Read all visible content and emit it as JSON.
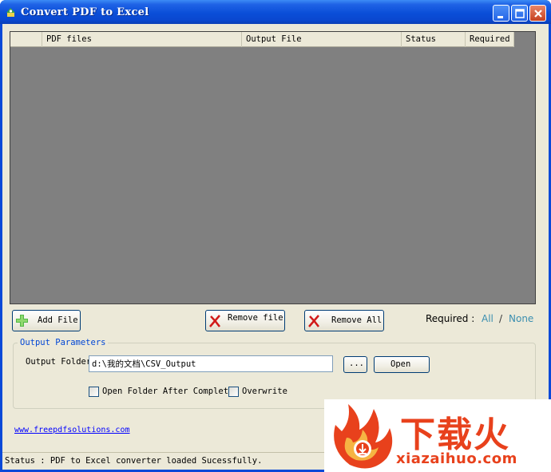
{
  "window": {
    "title": "Convert PDF to Excel",
    "icon": "app-logo-icon"
  },
  "grid": {
    "columns": [
      "",
      "PDF files",
      "Output File",
      "Status",
      "Required"
    ],
    "rows": []
  },
  "toolbar": {
    "add_file": "Add File",
    "remove_file": "Remove file",
    "remove_all": "Remove All"
  },
  "required": {
    "label": "Required :",
    "all": "All",
    "separator": "/",
    "none": "None"
  },
  "output_parameters": {
    "title": "Output Parameters",
    "folder_label": "Output Folder",
    "folder_value": "d:\\我的文档\\CSV_Output",
    "browse": "...",
    "open": "Open",
    "open_after_complete": "Open Folder After Complete",
    "open_after_complete_checked": false,
    "overwrite": "Overwrite",
    "overwrite_checked": false
  },
  "link": "www.freepdfsolutions.com",
  "status_bar": "Status : PDF to Excel converter loaded Sucessfully.",
  "watermark": {
    "logo_text": "下载火",
    "site": "xiazaihuo.com"
  },
  "colors": {
    "titlebar": "#0a4ed8",
    "client": "#ece9d8",
    "grid_bg": "#808080",
    "link": "#0000ff",
    "accent_required": "#3b8fb0",
    "watermark": "#e8411c"
  }
}
